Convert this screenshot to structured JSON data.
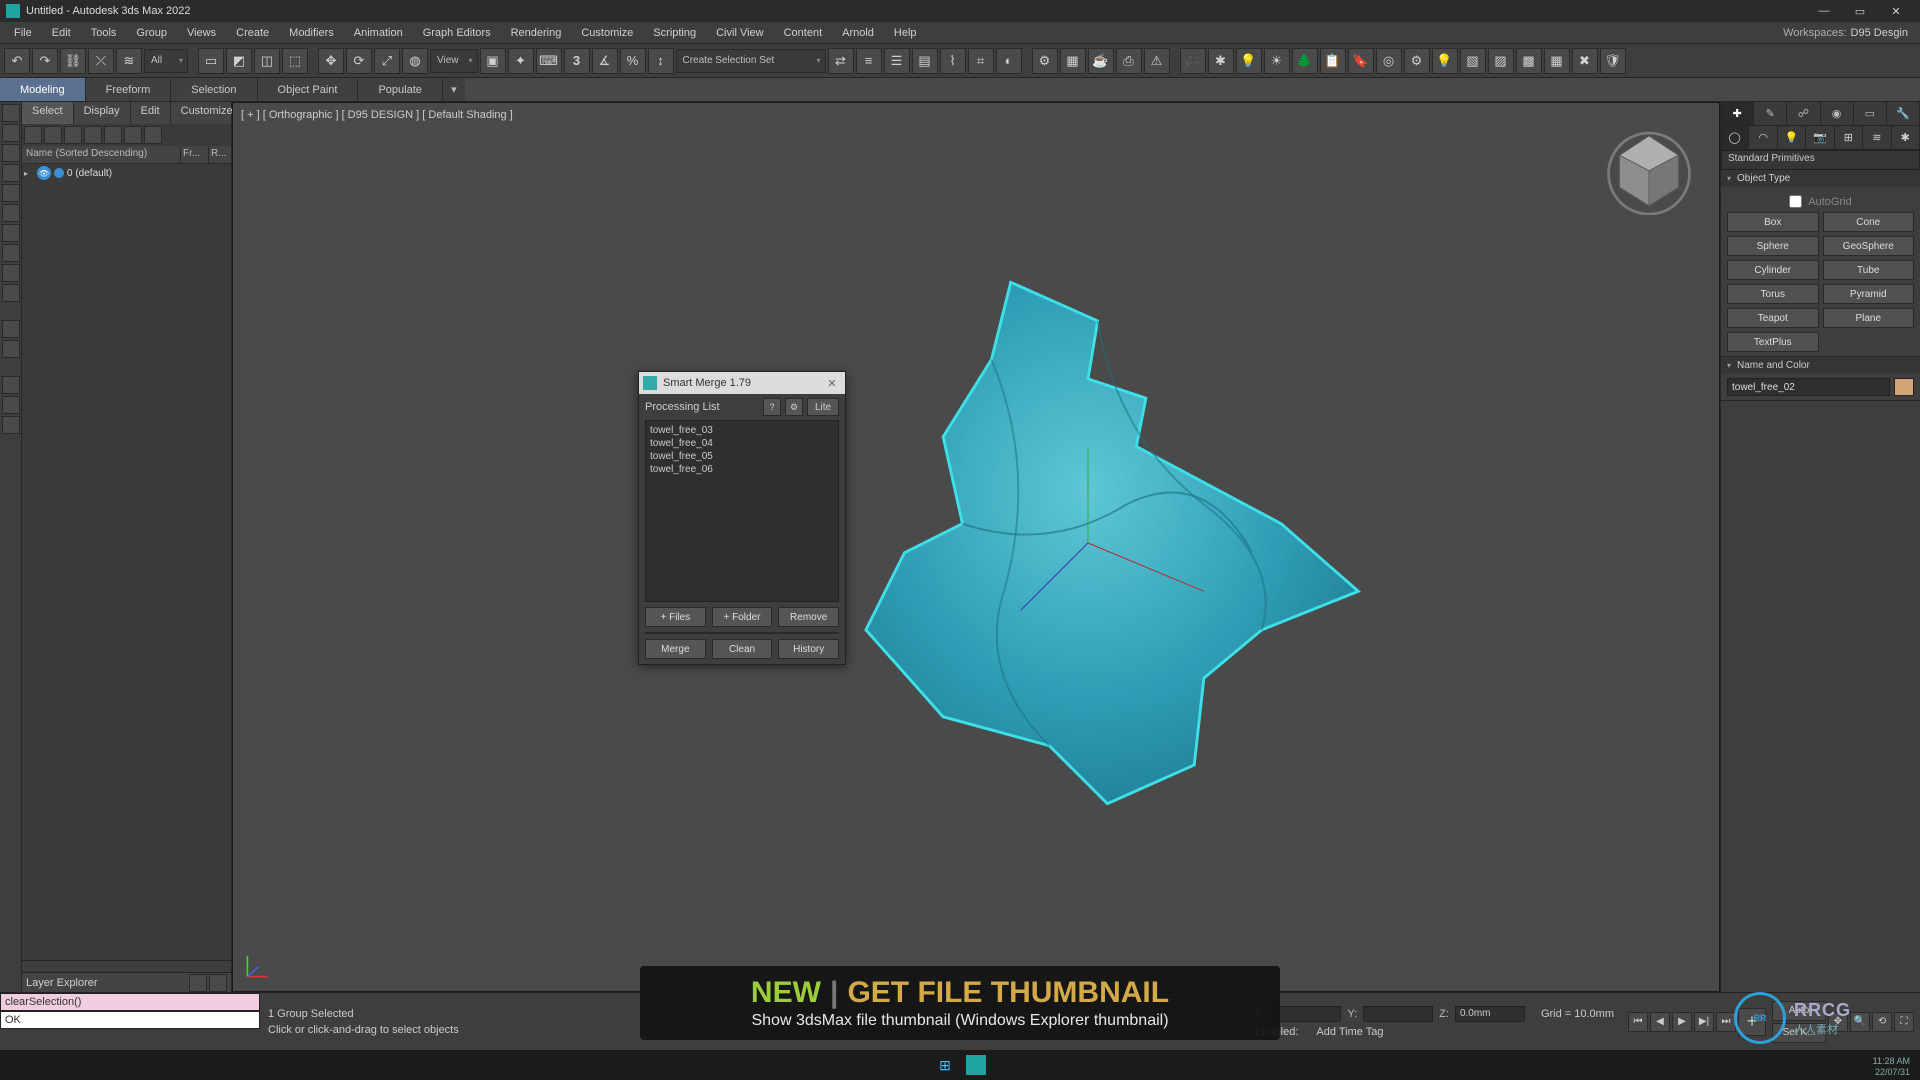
{
  "title": "Untitled - Autodesk 3ds Max 2022",
  "menus": [
    "File",
    "Edit",
    "Tools",
    "Group",
    "Views",
    "Create",
    "Modifiers",
    "Animation",
    "Graph Editors",
    "Rendering",
    "Customize",
    "Scripting",
    "Civil View",
    "Content",
    "Arnold",
    "Help"
  ],
  "workspace_label": "Workspaces:",
  "workspace_value": "D95 Desgin",
  "toolbar_dropdowns": {
    "all": "All",
    "view": "View",
    "selset": "Create Selection Set"
  },
  "ribbon_tabs": [
    "Modeling",
    "Freeform",
    "Selection",
    "Object Paint",
    "Populate"
  ],
  "scene_explorer": {
    "tabs": [
      "Select",
      "Display",
      "Edit",
      "Customize"
    ],
    "header": {
      "col1": "Name (Sorted Descending)",
      "col2": "Fr...",
      "col3": "R..."
    },
    "row": {
      "name": "0 (default)"
    },
    "footer": "Layer Explorer"
  },
  "viewport_label": "[ + ] [ Orthographic ] [ D95 DESIGN ] [ Default Shading ]",
  "dialog": {
    "title": "Smart Merge 1.79",
    "section": "Processing List",
    "lite": "Lite",
    "items": [
      "towel_free_03",
      "towel_free_04",
      "towel_free_05",
      "towel_free_06"
    ],
    "row1": [
      "+ Files",
      "+ Folder",
      "Remove"
    ],
    "row2": [
      "Merge",
      "Clean",
      "History"
    ]
  },
  "command_panel": {
    "dropdown": "Standard Primitives",
    "object_type": "Object Type",
    "autogrid": "AutoGrid",
    "prims": [
      [
        "Box",
        "Cone"
      ],
      [
        "Sphere",
        "GeoSphere"
      ],
      [
        "Cylinder",
        "Tube"
      ],
      [
        "Torus",
        "Pyramid"
      ],
      [
        "Teapot",
        "Plane"
      ],
      [
        "TextPlus",
        ""
      ]
    ],
    "name_and_color": "Name and Color",
    "object_name": "towel_free_02",
    "swatch": "#d2a679"
  },
  "status": {
    "macro_pink": "clearSelection()",
    "macro_white": "OK",
    "selected": "1 Group Selected",
    "hint": "Click or click-and-drag to select objects",
    "x_label": "X:",
    "x_val": "",
    "y_label": "Y:",
    "y_val": "",
    "z_label": "Z:",
    "z_val": "0.0mm",
    "grid": "Grid = 10.0mm",
    "enabled": "Enabled:",
    "addtag": "Add Time Tag",
    "auto": "Auto",
    "setk": "Set K..."
  },
  "banner": {
    "new": "NEW",
    "pipe": "|",
    "rest": "GET FILE THUMBNAIL",
    "sub": "Show 3dsMax file thumbnail (Windows Explorer thumbnail)"
  },
  "watermark": {
    "circle": "RR",
    "text": "RRCG",
    "sub": "人人素材"
  },
  "datetime": {
    "time": "11:28 AM",
    "date": "22/07/31"
  }
}
